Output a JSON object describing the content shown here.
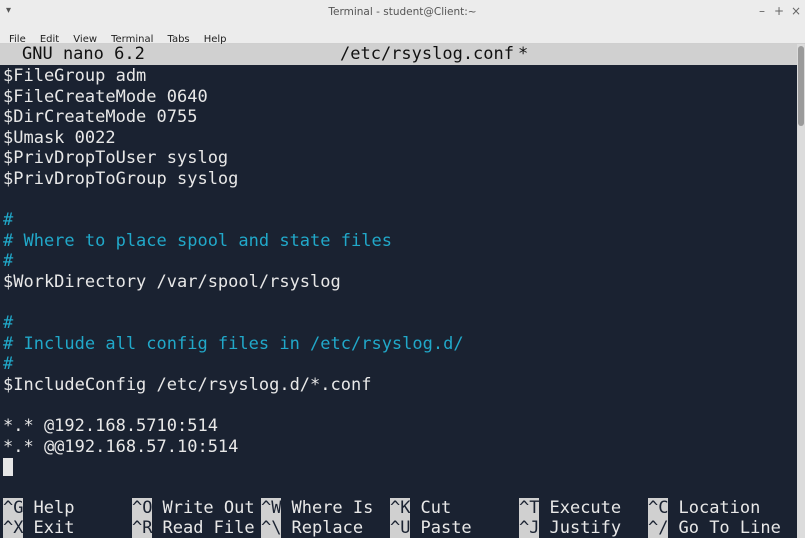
{
  "window": {
    "title": "Terminal - student@Client:~",
    "menu_glyph": "▾",
    "btn_minimize": "–",
    "btn_maximize": "+",
    "btn_close": "×"
  },
  "menubar": [
    "File",
    "Edit",
    "View",
    "Terminal",
    "Tabs",
    "Help"
  ],
  "nano": {
    "version": "GNU nano 6.2",
    "filename": "/etc/rsyslog.conf",
    "modified": "*"
  },
  "lines": [
    {
      "text": "$FileGroup adm",
      "type": "code"
    },
    {
      "text": "$FileCreateMode 0640",
      "type": "code"
    },
    {
      "text": "$DirCreateMode 0755",
      "type": "code"
    },
    {
      "text": "$Umask 0022",
      "type": "code"
    },
    {
      "text": "$PrivDropToUser syslog",
      "type": "code"
    },
    {
      "text": "$PrivDropToGroup syslog",
      "type": "code"
    },
    {
      "text": "",
      "type": "code"
    },
    {
      "text": "#",
      "type": "comment"
    },
    {
      "text": "# Where to place spool and state files",
      "type": "comment"
    },
    {
      "text": "#",
      "type": "comment"
    },
    {
      "text": "$WorkDirectory /var/spool/rsyslog",
      "type": "code"
    },
    {
      "text": "",
      "type": "code"
    },
    {
      "text": "#",
      "type": "comment"
    },
    {
      "text": "# Include all config files in /etc/rsyslog.d/",
      "type": "comment"
    },
    {
      "text": "#",
      "type": "comment"
    },
    {
      "text": "$IncludeConfig /etc/rsyslog.d/*.conf",
      "type": "code"
    },
    {
      "text": "",
      "type": "code"
    },
    {
      "text": "*.* @192.168.5710:514",
      "type": "code"
    },
    {
      "text": "*.* @@192.168.57.10:514",
      "type": "code"
    }
  ],
  "shortcuts": [
    {
      "key": "^G",
      "label": "Help"
    },
    {
      "key": "^O",
      "label": "Write Out"
    },
    {
      "key": "^W",
      "label": "Where Is"
    },
    {
      "key": "^K",
      "label": "Cut"
    },
    {
      "key": "^T",
      "label": "Execute"
    },
    {
      "key": "^C",
      "label": "Location"
    },
    {
      "key": "^X",
      "label": "Exit"
    },
    {
      "key": "^R",
      "label": "Read File"
    },
    {
      "key": "^\\",
      "label": "Replace"
    },
    {
      "key": "^U",
      "label": "Paste"
    },
    {
      "key": "^J",
      "label": "Justify"
    },
    {
      "key": "^/",
      "label": "Go To Line"
    }
  ],
  "colors": {
    "background": "#1a2231",
    "comment": "#21a8c9",
    "text": "#e8e8e8",
    "header_bg": "#d0d0d0"
  }
}
